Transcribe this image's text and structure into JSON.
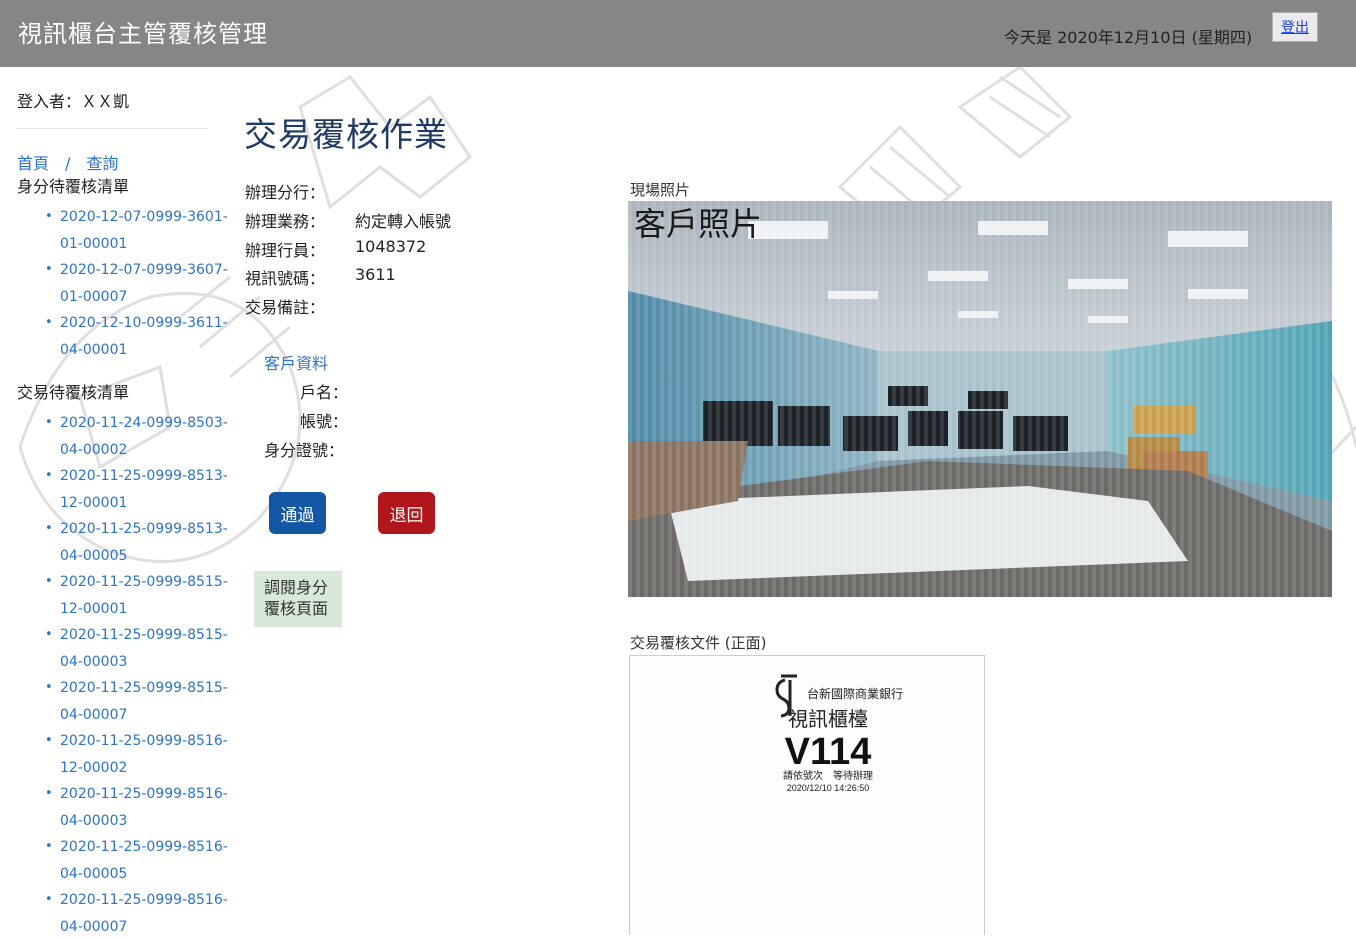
{
  "header": {
    "title": "視訊櫃台主管覆核管理",
    "date_text": "今天是 2020年12月10日 (星期四)",
    "logout_label": "登出"
  },
  "sidebar": {
    "login_user": "登入者：ＸＸ凱",
    "breadcrumb": {
      "home": "首頁",
      "separator": "/",
      "query": "查詢"
    },
    "identity_section_title": "身分待覆核清單",
    "identity_items": [
      [
        "2020-12-07-0999-3601-",
        "01-00001"
      ],
      [
        "2020-12-07-0999-3607-",
        "01-00007"
      ],
      [
        "2020-12-10-0999-3611-",
        "04-00001"
      ]
    ],
    "transaction_section_title": "交易待覆核清單",
    "transaction_items": [
      [
        "2020-11-24-0999-8503-",
        "04-00002"
      ],
      [
        "2020-11-25-0999-8513-",
        "12-00001"
      ],
      [
        "2020-11-25-0999-8513-",
        "04-00005"
      ],
      [
        "2020-11-25-0999-8515-",
        "12-00001"
      ],
      [
        "2020-11-25-0999-8515-",
        "04-00003"
      ],
      [
        "2020-11-25-0999-8515-",
        "04-00007"
      ],
      [
        "2020-11-25-0999-8516-",
        "12-00002"
      ],
      [
        "2020-11-25-0999-8516-",
        "04-00003"
      ],
      [
        "2020-11-25-0999-8516-",
        "04-00005"
      ],
      [
        "2020-11-25-0999-8516-",
        "04-00007"
      ]
    ]
  },
  "main": {
    "title": "交易覆核作業",
    "fields": [
      {
        "label": "辦理分行：",
        "value": ""
      },
      {
        "label": "辦理業務：",
        "value": "約定轉入帳號"
      },
      {
        "label": "辦理行員：",
        "value": "1048372"
      },
      {
        "label": "視訊號碼：",
        "value": "3611"
      },
      {
        "label": "交易備註：",
        "value": ""
      }
    ],
    "customer_section": "客戶資料",
    "customer_fields": [
      {
        "label": "戶名：",
        "value": ""
      },
      {
        "label": "帳號：",
        "value": ""
      },
      {
        "label": "身分證號：",
        "value": ""
      }
    ],
    "approve_label": "通過",
    "return_label": "退回",
    "identity_review_label": "調閱身分覆核頁面",
    "photo_section_label": "現場照片",
    "photo_overlay_text": "客戶照片",
    "document_section_label": "交易覆核文件 (正面)",
    "document": {
      "bank_name": "台新國際商業銀行",
      "counter_title": "視訊櫃檯",
      "ticket_number": "V114",
      "instruction": "請依號次　等待辦理",
      "timestamp": "2020/12/10 14:26:50"
    }
  },
  "colors": {
    "header_bg": "#868686",
    "link": "#2c74c4",
    "approve": "#1356a4",
    "return": "#b0161a",
    "identity_button_bg": "#d7ead7"
  }
}
